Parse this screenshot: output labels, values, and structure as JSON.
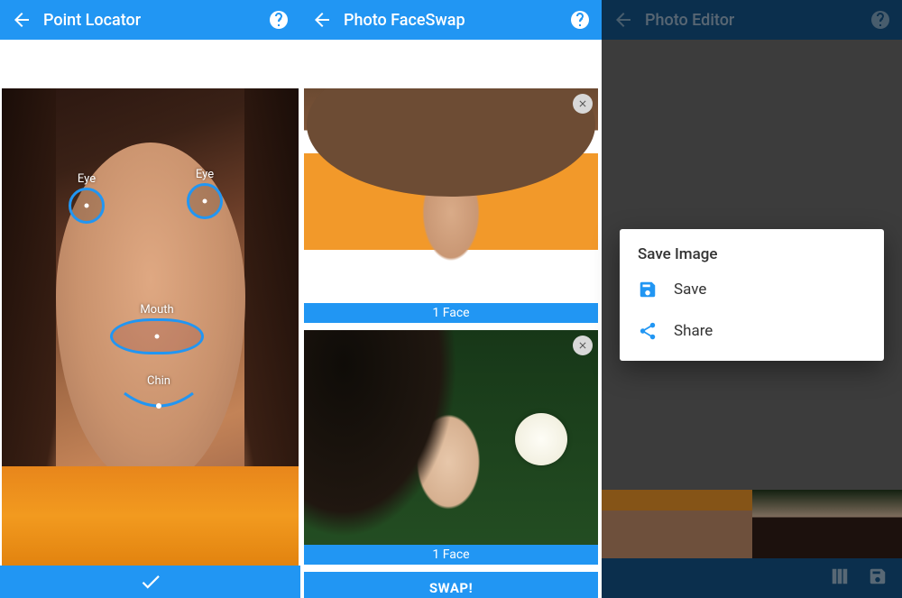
{
  "panel1": {
    "title": "Point Locator",
    "markers": {
      "eye_left": "Eye",
      "eye_right": "Eye",
      "mouth": "Mouth",
      "chin": "Chin"
    }
  },
  "panel2": {
    "title": "Photo FaceSwap",
    "face_count_a": "1 Face",
    "face_count_b": "1 Face",
    "swap_label": "SWAP!"
  },
  "panel3": {
    "title": "Photo Editor",
    "dialog": {
      "title": "Save Image",
      "save": "Save",
      "share": "Share"
    }
  }
}
